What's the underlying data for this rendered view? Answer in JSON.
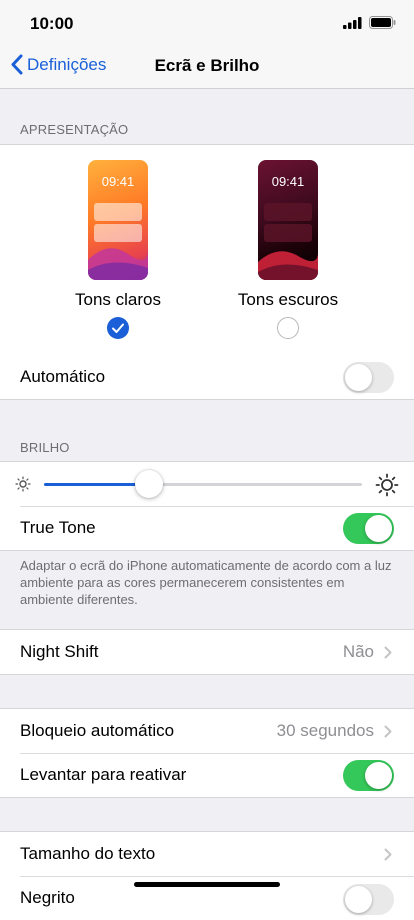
{
  "status": {
    "time": "10:00"
  },
  "nav": {
    "back_label": "Definições",
    "title": "Ecrã e Brilho"
  },
  "appearance": {
    "header": "APRESENTAÇÃO",
    "light": {
      "time": "09:41",
      "label": "Tons claros",
      "selected": true
    },
    "dark": {
      "time": "09:41",
      "label": "Tons escuros",
      "selected": false
    },
    "automatic_label": "Automático",
    "automatic_on": false
  },
  "brightness": {
    "header": "BRILHO",
    "level": 0.33,
    "true_tone_label": "True Tone",
    "true_tone_on": true,
    "description": "Adaptar o ecrã do iPhone automaticamente de acordo com a luz ambiente para as cores permanecerem consistentes em ambiente diferentes."
  },
  "night_shift": {
    "label": "Night Shift",
    "value": "Não"
  },
  "lock": {
    "auto_lock_label": "Bloqueio automático",
    "auto_lock_value": "30 segundos",
    "raise_label": "Levantar para reativar",
    "raise_on": true
  },
  "text": {
    "text_size_label": "Tamanho do texto",
    "bold_label": "Negrito"
  },
  "colors": {
    "accent": "#1a5fd8",
    "toggle_on": "#34c759"
  }
}
